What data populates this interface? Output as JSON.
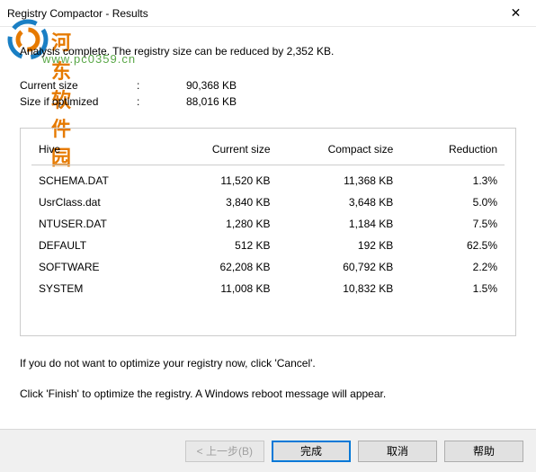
{
  "window": {
    "title": "Registry Compactor - Results"
  },
  "watermark": {
    "main": "河东软件园",
    "sub": "www.pc0359.cn"
  },
  "summary": "Analysis complete. The registry size can be reduced by 2,352 KB.",
  "stats": {
    "current_label": "Current size",
    "current_value": "90,368 KB",
    "optimized_label": "Size if optimized",
    "optimized_value": "88,016 KB"
  },
  "table": {
    "headers": {
      "hive": "Hive",
      "current": "Current size",
      "compact": "Compact size",
      "reduction": "Reduction"
    },
    "rows": [
      {
        "hive": "SCHEMA.DAT",
        "current": "11,520 KB",
        "compact": "11,368 KB",
        "reduction": "1.3%"
      },
      {
        "hive": "UsrClass.dat",
        "current": "3,840 KB",
        "compact": "3,648 KB",
        "reduction": "5.0%"
      },
      {
        "hive": "NTUSER.DAT",
        "current": "1,280 KB",
        "compact": "1,184 KB",
        "reduction": "7.5%"
      },
      {
        "hive": "DEFAULT",
        "current": "512 KB",
        "compact": "192 KB",
        "reduction": "62.5%"
      },
      {
        "hive": "SOFTWARE",
        "current": "62,208 KB",
        "compact": "60,792 KB",
        "reduction": "2.2%"
      },
      {
        "hive": "SYSTEM",
        "current": "11,008 KB",
        "compact": "10,832 KB",
        "reduction": "1.5%"
      }
    ]
  },
  "instructions": {
    "line1": "If you do not want to optimize your registry now, click 'Cancel'.",
    "line2": "Click 'Finish' to optimize the registry. A Windows reboot message will appear."
  },
  "buttons": {
    "back": "< 上一步(B)",
    "finish": "完成",
    "cancel": "取消",
    "help": "帮助"
  }
}
